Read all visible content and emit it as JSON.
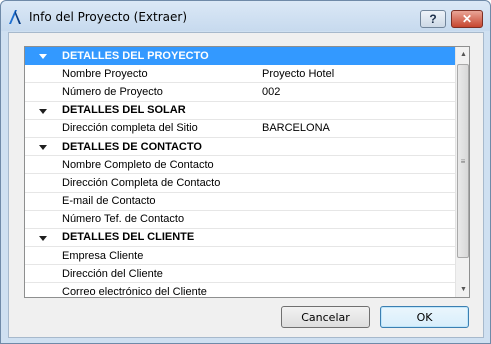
{
  "window": {
    "title": "Info del Proyecto (Extraer)",
    "help_glyph": "?",
    "close_glyph": "✕"
  },
  "list": {
    "rows": [
      {
        "type": "section",
        "label": "DETALLES DEL PROYECTO",
        "value": "",
        "selected": true
      },
      {
        "type": "item",
        "label": "Nombre Proyecto",
        "value": "Proyecto Hotel"
      },
      {
        "type": "item",
        "label": "Número de Proyecto",
        "value": "002"
      },
      {
        "type": "section",
        "label": "DETALLES DEL SOLAR",
        "value": ""
      },
      {
        "type": "item",
        "label": "Dirección completa del Sitio",
        "value": "BARCELONA"
      },
      {
        "type": "section",
        "label": "DETALLES DE CONTACTO",
        "value": ""
      },
      {
        "type": "item",
        "label": "Nombre Completo de Contacto",
        "value": ""
      },
      {
        "type": "item",
        "label": "Dirección Completa de Contacto",
        "value": ""
      },
      {
        "type": "item",
        "label": "E-mail de Contacto",
        "value": ""
      },
      {
        "type": "item",
        "label": "Número Tef. de Contacto",
        "value": ""
      },
      {
        "type": "section",
        "label": "DETALLES DEL CLIENTE",
        "value": ""
      },
      {
        "type": "item",
        "label": "Empresa Cliente",
        "value": ""
      },
      {
        "type": "item",
        "label": "Dirección del Cliente",
        "value": ""
      },
      {
        "type": "item",
        "label": "Correo electrónico del Cliente",
        "value": ""
      }
    ]
  },
  "buttons": {
    "cancel": "Cancelar",
    "ok": "OK"
  },
  "colors": {
    "selection": "#3399ff",
    "dialog_bg": "#f0f0f0",
    "frame": "#cfe0f1"
  }
}
